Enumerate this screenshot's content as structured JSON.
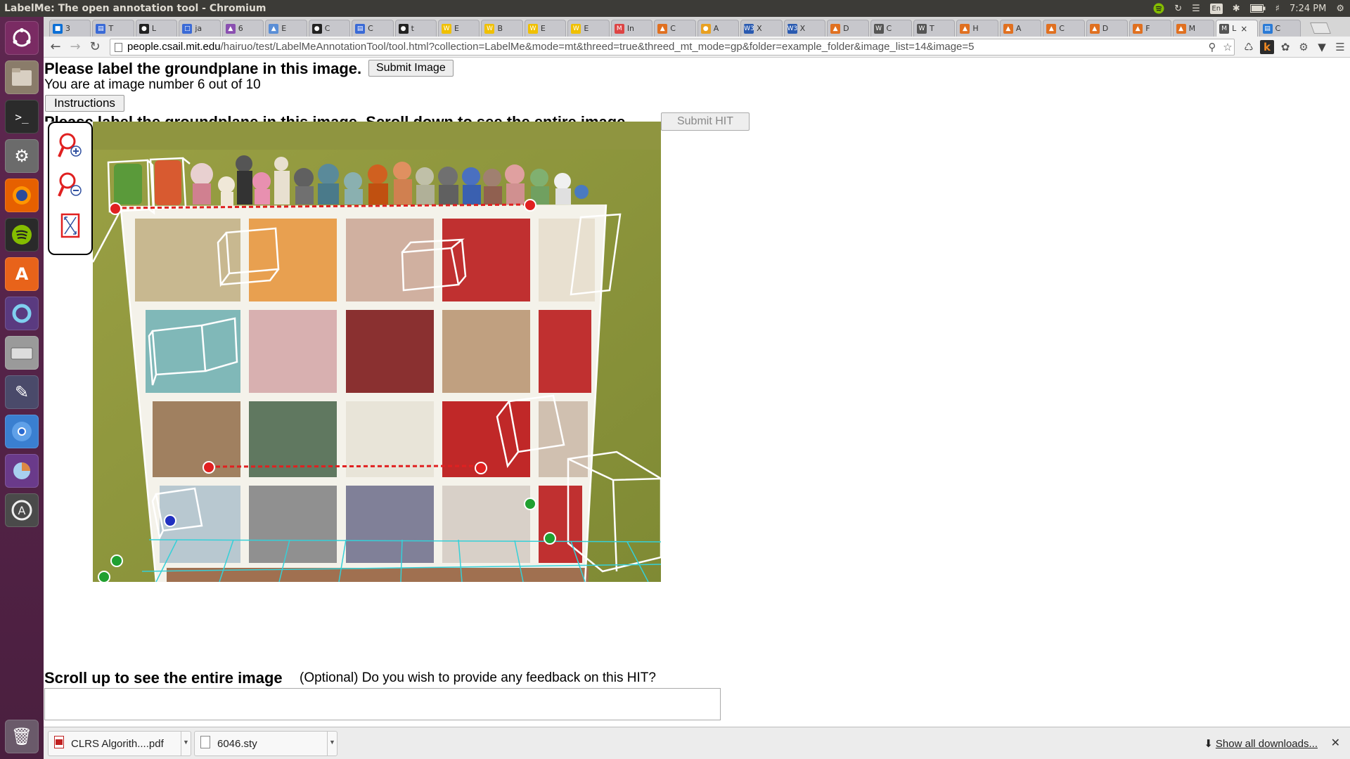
{
  "window": {
    "title": "LabelMe: The open annotation tool - Chromium"
  },
  "panel": {
    "keyboard": "En",
    "time": "7:24 PM"
  },
  "tabs": [
    {
      "label": "3",
      "fav": "#0b6fd6",
      "glyph": "■"
    },
    {
      "label": "T",
      "fav": "#3a6ad6",
      "glyph": "▤"
    },
    {
      "label": "L",
      "fav": "#222",
      "glyph": "●"
    },
    {
      "label": "ja",
      "fav": "#3a6ad6",
      "glyph": "□"
    },
    {
      "label": "6",
      "fav": "#8a4fb0",
      "glyph": "▲"
    },
    {
      "label": "E",
      "fav": "#5a8ed6",
      "glyph": "▲"
    },
    {
      "label": "C",
      "fav": "#222",
      "glyph": "●"
    },
    {
      "label": "C",
      "fav": "#3a6ad6",
      "glyph": "▤"
    },
    {
      "label": "t",
      "fav": "#222",
      "glyph": "●"
    },
    {
      "label": "E",
      "fav": "#f0c000",
      "glyph": "W"
    },
    {
      "label": "B",
      "fav": "#f0c000",
      "glyph": "W"
    },
    {
      "label": "E",
      "fav": "#f0c000",
      "glyph": "W"
    },
    {
      "label": "E",
      "fav": "#f0c000",
      "glyph": "W"
    },
    {
      "label": "In",
      "fav": "#d44",
      "glyph": "M"
    },
    {
      "label": "C",
      "fav": "#e07020",
      "glyph": "▲"
    },
    {
      "label": "A",
      "fav": "#e8a020",
      "glyph": "●"
    },
    {
      "label": "X",
      "fav": "#2a5ab0",
      "glyph": "W3"
    },
    {
      "label": "X",
      "fav": "#2a5ab0",
      "glyph": "W3"
    },
    {
      "label": "D",
      "fav": "#e07020",
      "glyph": "▲"
    },
    {
      "label": "C",
      "fav": "#555",
      "glyph": "W"
    },
    {
      "label": "T",
      "fav": "#555",
      "glyph": "W"
    },
    {
      "label": "H",
      "fav": "#e07020",
      "glyph": "▲"
    },
    {
      "label": "A",
      "fav": "#e07020",
      "glyph": "▲"
    },
    {
      "label": "C",
      "fav": "#e07020",
      "glyph": "▲"
    },
    {
      "label": "D",
      "fav": "#e07020",
      "glyph": "▲"
    },
    {
      "label": "F",
      "fav": "#e07020",
      "glyph": "▲"
    },
    {
      "label": "M",
      "fav": "#e07020",
      "glyph": "▲"
    },
    {
      "label": "L",
      "fav": "#555",
      "glyph": "M"
    },
    {
      "label": "C",
      "fav": "#2a7ad6",
      "glyph": "▤"
    }
  ],
  "toolbar": {
    "url_host": "people.csail.mit.edu",
    "url_path": "/hairuo/test/LabelMeAnnotationTool/tool.html?collection=LabelMe&mode=mt&threed=true&threed_mt_mode=gp&folder=example_folder&image_list=14&image=5"
  },
  "page": {
    "heading1": "Please label the groundplane in this image.",
    "submit_image_label": "Submit Image",
    "image_counter": "You are at image number 6 out of 10",
    "instructions_label": "Instructions",
    "heading2": "Please label the groundplane in this image. Scroll down to see the entire image.",
    "submit_hit_label": "Submit HIT",
    "scroll_msg": "Scroll up to see the entire image",
    "feedback_label": "(Optional) Do you wish to provide any feedback on this HIT?",
    "feedback_value": ""
  },
  "downloads": {
    "items": [
      {
        "name": "CLRS Algorith....pdf",
        "icon": "pdf-icon"
      },
      {
        "name": "6046.sty",
        "icon": "file-icon"
      }
    ],
    "show_all": "Show all downloads..."
  }
}
